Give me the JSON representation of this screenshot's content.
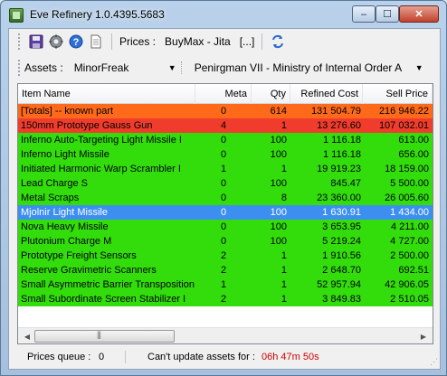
{
  "window": {
    "title": "Eve Refinery 1.0.4395.5683",
    "controls": {
      "minimize": "–",
      "maximize": "☐",
      "close": "✕"
    }
  },
  "toolbar": {
    "prices_label": "Prices :",
    "prices_value": "BuyMax - Jita",
    "ellipsis": "[...]",
    "icons": [
      "save-icon",
      "settings-icon",
      "help-icon",
      "document-icon",
      "refresh-icon"
    ]
  },
  "assets_bar": {
    "label": "Assets :",
    "owner": "MinorFreak",
    "location": "Penirgman VII - Ministry of Internal Order A"
  },
  "grid": {
    "columns": [
      "Item Name",
      "Meta",
      "Qty",
      "Refined Cost",
      "Sell Price"
    ],
    "rows": [
      {
        "name": "[Totals] -- known part",
        "meta": "0",
        "qty": "614",
        "cost": "131 504.79",
        "sell": "216 946.22",
        "color": "#ff6a1a"
      },
      {
        "name": "150mm Prototype Gauss Gun",
        "meta": "4",
        "qty": "1",
        "cost": "13 276.60",
        "sell": "107 032.01",
        "color": "#f03c2c"
      },
      {
        "name": "Inferno Auto-Targeting Light Missile I",
        "meta": "0",
        "qty": "100",
        "cost": "1 116.18",
        "sell": "613.00",
        "color": "#33dd0c"
      },
      {
        "name": "Inferno Light Missile",
        "meta": "0",
        "qty": "100",
        "cost": "1 116.18",
        "sell": "656.00",
        "color": "#33dd0c"
      },
      {
        "name": "Initiated Harmonic Warp Scrambler I",
        "meta": "1",
        "qty": "1",
        "cost": "19 919.23",
        "sell": "18 159.00",
        "color": "#33dd0c"
      },
      {
        "name": "Lead Charge S",
        "meta": "0",
        "qty": "100",
        "cost": "845.47",
        "sell": "5 500.00",
        "color": "#33dd0c"
      },
      {
        "name": "Metal Scraps",
        "meta": "0",
        "qty": "8",
        "cost": "23 360.00",
        "sell": "26 005.60",
        "color": "#33dd0c"
      },
      {
        "name": "Mjolnir Light Missile",
        "meta": "0",
        "qty": "100",
        "cost": "1 630.91",
        "sell": "1 434.00",
        "color": "#3c8ff0",
        "text_color": "#ffffff"
      },
      {
        "name": "Nova Heavy Missile",
        "meta": "0",
        "qty": "100",
        "cost": "3 653.95",
        "sell": "4 211.00",
        "color": "#33dd0c"
      },
      {
        "name": "Plutonium Charge M",
        "meta": "0",
        "qty": "100",
        "cost": "5 219.24",
        "sell": "4 727.00",
        "color": "#33dd0c"
      },
      {
        "name": "Prototype Freight Sensors",
        "meta": "2",
        "qty": "1",
        "cost": "1 910.56",
        "sell": "2 500.00",
        "color": "#33dd0c"
      },
      {
        "name": "Reserve Gravimetric Scanners",
        "meta": "2",
        "qty": "1",
        "cost": "2 648.70",
        "sell": "692.51",
        "color": "#33dd0c"
      },
      {
        "name": "Small Asymmetric Barrier Transposition...",
        "meta": "1",
        "qty": "1",
        "cost": "52 957.94",
        "sell": "42 906.05",
        "color": "#33dd0c"
      },
      {
        "name": "Small Subordinate Screen Stabilizer I",
        "meta": "2",
        "qty": "1",
        "cost": "3 849.83",
        "sell": "2 510.05",
        "color": "#33dd0c"
      }
    ]
  },
  "status": {
    "queue_label": "Prices queue :",
    "queue_value": "0",
    "update_label": "Can't update assets for :",
    "update_value": "06h 47m 50s"
  }
}
